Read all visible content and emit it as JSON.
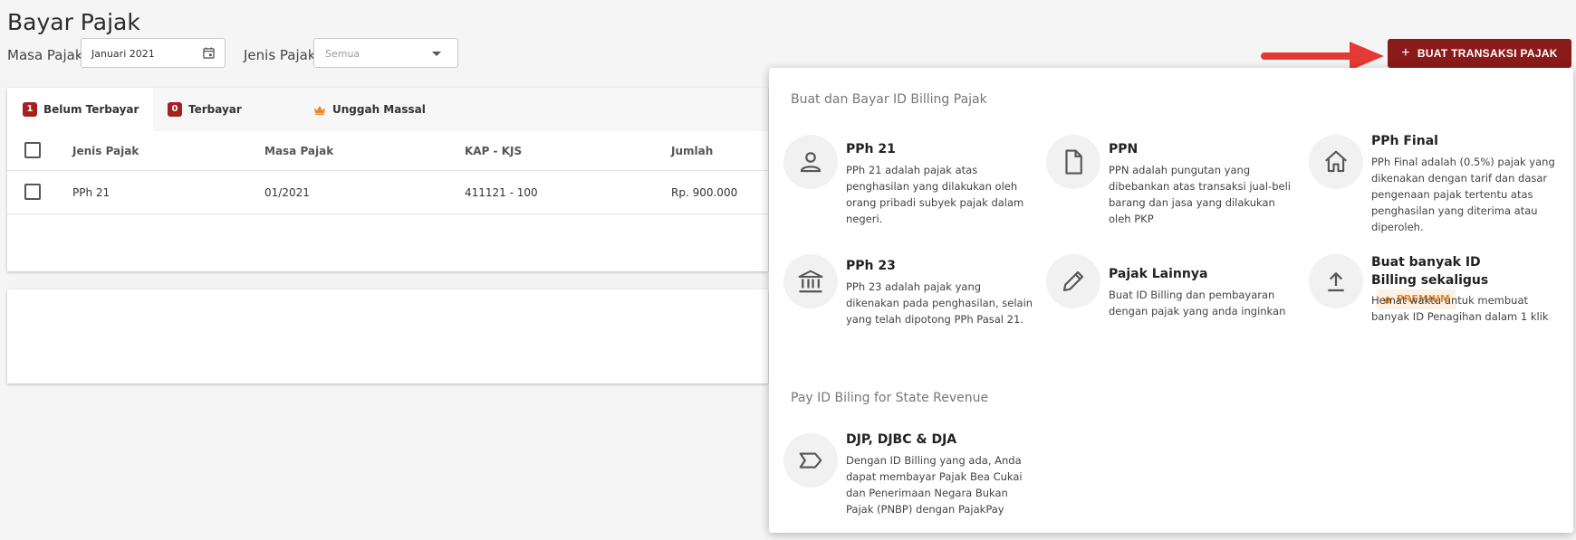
{
  "page": {
    "title": "Bayar Pajak"
  },
  "filters": {
    "masa_label": "Masa Pajak",
    "masa_value": "Januari 2021",
    "jenis_label": "Jenis Pajak",
    "jenis_placeholder": "Semua"
  },
  "tabs": [
    {
      "label": "Belum Terbayar",
      "count": "1"
    },
    {
      "label": "Terbayar",
      "count": "0"
    },
    {
      "label": "Unggah Massal",
      "icon": "crown-icon"
    }
  ],
  "table": {
    "headers": [
      "Jenis Pajak",
      "Masa Pajak",
      "KAP - KJS",
      "Jumlah"
    ],
    "rows": [
      [
        "PPh 21",
        "01/2021",
        "411121 - 100",
        "Rp. 900.000"
      ]
    ]
  },
  "action_button": {
    "label": "BUAT TRANSAKSI PAJAK",
    "icon": "plus-icon"
  },
  "colors": {
    "primary": "#8b1a1a",
    "badge": "#a52020",
    "premium": "#e8892b",
    "arrow": "#e53935"
  },
  "panel": {
    "section1_title": "Buat dan Bayar ID Billing Pajak",
    "section2_title": "Pay ID Biling for State Revenue",
    "options": [
      {
        "title": "PPh 21",
        "desc": "PPh 21 adalah pajak atas penghasilan yang dilakukan oleh orang pribadi subyek pajak dalam negeri.",
        "icon": "person-icon"
      },
      {
        "title": "PPN",
        "desc": "PPN adalah pungutan yang dibebankan atas transaksi jual-beli barang dan jasa yang dilakukan oleh PKP",
        "icon": "document-icon"
      },
      {
        "title": "PPh Final",
        "desc": "PPh Final adalah (0.5%) pajak yang dikenakan dengan tarif dan dasar pengenaan pajak tertentu atas penghasilan yang diterima atau diperoleh.",
        "icon": "home-icon"
      },
      {
        "title": "PPh 23",
        "desc": "PPh 23 adalah pajak yang dikenakan pada penghasilan, selain yang telah dipotong PPh Pasal 21.",
        "icon": "bank-icon"
      },
      {
        "title": "Pajak Lainnya",
        "desc": "Buat ID Billing dan pembayaran dengan pajak yang anda inginkan",
        "icon": "pencil-icon"
      },
      {
        "title": "Buat banyak ID Billing sekaligus",
        "badge": "PREMIUM",
        "desc": "Hemat waktu untuk membuat banyak ID Penagihan dalam 1 klik",
        "icon": "upload-icon"
      },
      {
        "title": "DJP, DJBC & DJA",
        "desc": "Dengan ID Billing yang ada, Anda dapat membayar Pajak Bea Cukai dan Penerimaan Negara Bukan Pajak (PNBP) dengan PajakPay",
        "icon": "label-arrow-icon"
      }
    ]
  }
}
